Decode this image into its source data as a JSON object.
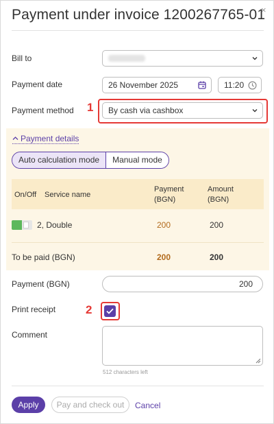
{
  "dialog": {
    "title": "Payment under invoice 1200267765-01",
    "close_glyph": "×"
  },
  "form": {
    "bill_to_label": "Bill to",
    "payment_date_label": "Payment date",
    "payment_date_value": "26 November 2025",
    "payment_time_value": "11:20",
    "payment_method_label": "Payment method",
    "payment_method_value": "By cash via cashbox",
    "payment_label": "Payment (BGN)",
    "payment_value": "200",
    "print_receipt_label": "Print receipt",
    "print_receipt_checked": true,
    "comment_label": "Comment",
    "comment_chars_left": "512 characters left"
  },
  "details": {
    "toggle_label": "Payment details",
    "modes": [
      "Auto calculation mode",
      "Manual mode"
    ],
    "active_mode": "Auto calculation mode",
    "headers": {
      "onoff": "On/Off",
      "service": "Service name",
      "payment_l1": "Payment",
      "payment_l2": "(BGN)",
      "amount_l1": "Amount",
      "amount_l2": "(BGN)"
    },
    "rows": [
      {
        "enabled": true,
        "service": "2, Double",
        "payment": "200",
        "amount": "200"
      }
    ],
    "total": {
      "label": "To be paid (BGN)",
      "payment": "200",
      "amount": "200"
    }
  },
  "markers": {
    "one": "1",
    "two": "2"
  },
  "actions": {
    "apply": "Apply",
    "pay_checkout": "Pay and check out",
    "cancel": "Cancel"
  },
  "colors": {
    "accent": "#5b3fa8",
    "marker": "#e53935",
    "details_bg": "#fdf6e6",
    "header_bg": "#faebc9",
    "toggle_on": "#5cb85c"
  },
  "icons": {
    "close": "close-icon",
    "calendar": "calendar-icon",
    "clock": "clock-icon",
    "dropdown": "chevron-down-icon",
    "check": "check-icon",
    "resize": "resize-handle-icon"
  }
}
